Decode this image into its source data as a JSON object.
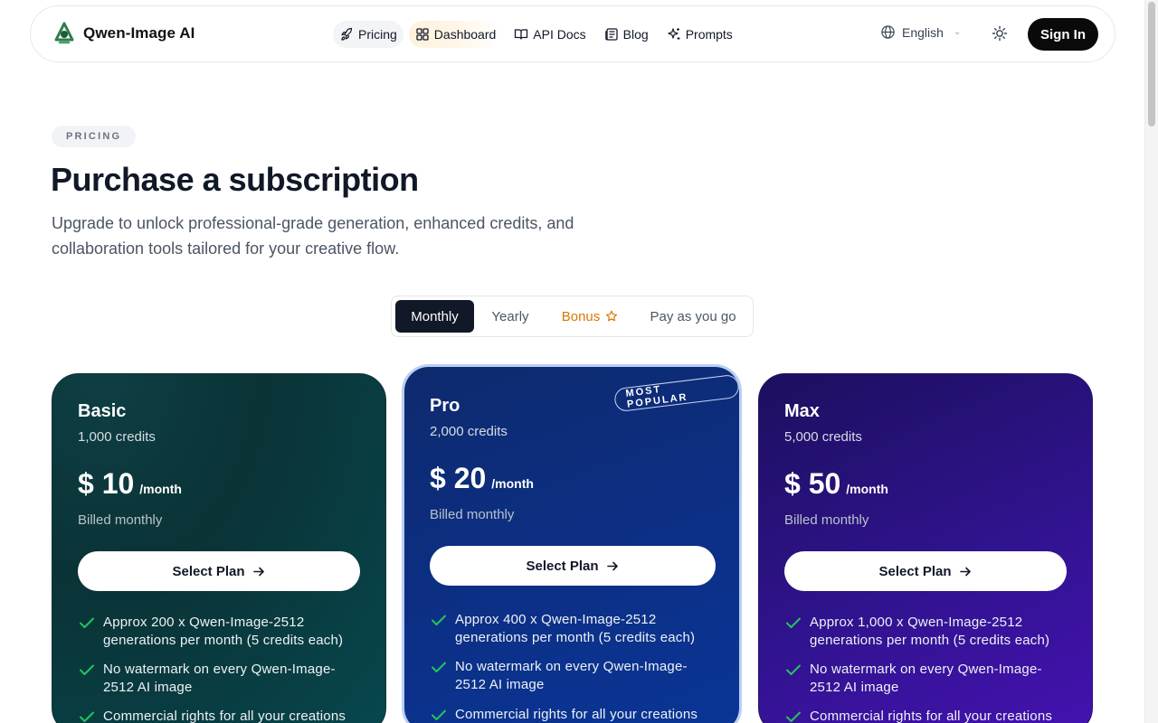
{
  "header": {
    "brand": "Qwen-Image AI",
    "nav": [
      {
        "label": "Pricing",
        "icon": "rocket-icon"
      },
      {
        "label": "Dashboard",
        "icon": "grid-icon"
      },
      {
        "label": "API Docs",
        "icon": "book-icon"
      },
      {
        "label": "Blog",
        "icon": "newspaper-icon"
      },
      {
        "label": "Prompts",
        "icon": "sparkles-icon"
      }
    ],
    "language": "English",
    "sign_in": "Sign In"
  },
  "hero": {
    "badge": "PRICING",
    "title": "Purchase a subscription",
    "subtitle": "Upgrade to unlock professional-grade generation, enhanced credits, and collaboration tools tailored for your creative flow."
  },
  "tabs": [
    {
      "label": "Monthly",
      "active": true
    },
    {
      "label": "Yearly",
      "active": false
    },
    {
      "label": "Bonus",
      "active": false
    },
    {
      "label": "Pay as you go",
      "active": false
    }
  ],
  "plans": [
    {
      "name": "Basic",
      "credits": "1,000 credits",
      "price": "$ 10",
      "period": "/month",
      "billed": "Billed monthly",
      "button": "Select Plan",
      "features": [
        "Approx 200 x Qwen-Image-2512 generations per month (5 credits each)",
        "No watermark on every Qwen-Image-2512 AI image",
        "Commercial rights for all your creations"
      ]
    },
    {
      "name": "Pro",
      "badge": "MOST POPULAR",
      "credits": "2,000 credits",
      "price": "$ 20",
      "period": "/month",
      "billed": "Billed monthly",
      "button": "Select Plan",
      "features": [
        "Approx 400 x Qwen-Image-2512 generations per month (5 credits each)",
        "No watermark on every Qwen-Image-2512 AI image",
        "Commercial rights for all your creations"
      ]
    },
    {
      "name": "Max",
      "credits": "5,000 credits",
      "price": "$ 50",
      "period": "/month",
      "billed": "Billed monthly",
      "button": "Select Plan",
      "features": [
        "Approx 1,000 x Qwen-Image-2512 generations per month (5 credits each)",
        "No watermark on every Qwen-Image-2512 AI image",
        "Commercial rights for all your creations"
      ]
    }
  ],
  "colors": {
    "check": "#22c55e",
    "bonus": "#d97706",
    "primary": "#111827"
  }
}
